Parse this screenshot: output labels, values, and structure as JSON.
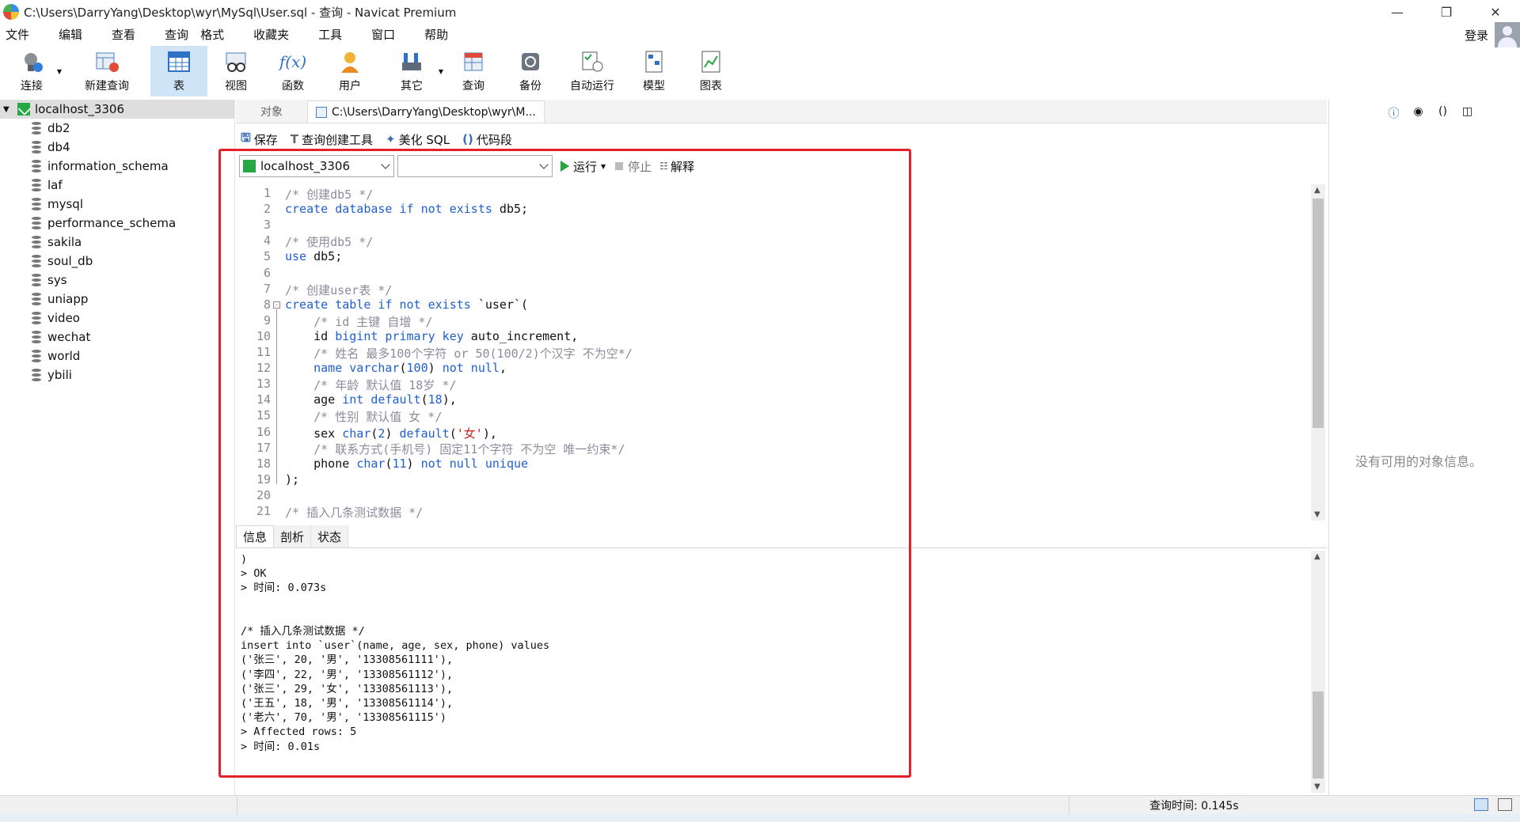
{
  "window": {
    "title": "C:\\Users\\DarryYang\\Desktop\\wyr\\MySql\\User.sql - 查询 - Navicat Premium"
  },
  "menu": [
    "文件",
    "编辑",
    "查看",
    "查询",
    "格式",
    "收藏夹",
    "工具",
    "窗口",
    "帮助"
  ],
  "login_label": "登录",
  "toolbar": [
    {
      "label": "连接",
      "icon": "plug-icon"
    },
    {
      "label": "新建查询",
      "icon": "new-query-icon"
    },
    {
      "label": "表",
      "icon": "table-icon"
    },
    {
      "label": "视图",
      "icon": "view-icon"
    },
    {
      "label": "函数",
      "icon": "function-icon"
    },
    {
      "label": "用户",
      "icon": "user-icon"
    },
    {
      "label": "其它",
      "icon": "other-icon"
    },
    {
      "label": "查询",
      "icon": "query-icon"
    },
    {
      "label": "备份",
      "icon": "backup-icon"
    },
    {
      "label": "自动运行",
      "icon": "auto-run-icon"
    },
    {
      "label": "模型",
      "icon": "model-icon"
    },
    {
      "label": "图表",
      "icon": "chart-icon"
    }
  ],
  "nav": {
    "root": "localhost_3306",
    "databases": [
      "db2",
      "db4",
      "information_schema",
      "laf",
      "mysql",
      "performance_schema",
      "sakila",
      "soul_db",
      "sys",
      "uniapp",
      "video",
      "wechat",
      "world",
      "ybili"
    ]
  },
  "tabs": {
    "objects": "对象",
    "query_tab": "C:\\Users\\DarryYang\\Desktop\\wyr\\M..."
  },
  "query_toolbar": {
    "save": "保存",
    "builder": "查询创建工具",
    "beautify": "美化 SQL",
    "snippet": "代码段"
  },
  "conn_select": "localhost_3306",
  "db_select": "",
  "run": "运行",
  "stop": "停止",
  "explain": "解释",
  "editor_lines": [
    {
      "n": "1",
      "html": "<span class='cm'>/* 创建db5 */</span>"
    },
    {
      "n": "2",
      "html": "<span class='kw'>create database if not exists</span> db5;"
    },
    {
      "n": "3",
      "html": ""
    },
    {
      "n": "4",
      "html": "<span class='cm'>/* 使用db5 */</span>"
    },
    {
      "n": "5",
      "html": "<span class='kw'>use</span> db5;"
    },
    {
      "n": "6",
      "html": ""
    },
    {
      "n": "7",
      "html": "<span class='cm'>/* 创建user表 */</span>"
    },
    {
      "n": "8",
      "html": "<span class='kw'>create table if not exists</span> `user`("
    },
    {
      "n": "9",
      "html": "    <span class='cm'>/* id 主键 自增 */</span>"
    },
    {
      "n": "10",
      "html": "    id <span class='kw'>bigint primary key</span> auto_increment,"
    },
    {
      "n": "11",
      "html": "    <span class='cm'>/* 姓名 最多100个字符 or 50(100/2)个汉字 不为空*/</span>"
    },
    {
      "n": "12",
      "html": "    <span class='kw'>name varchar</span>(<span class='kw'>100</span>) <span class='kw'>not null</span>,"
    },
    {
      "n": "13",
      "html": "    <span class='cm'>/* 年龄 默认值 18岁 */</span>"
    },
    {
      "n": "14",
      "html": "    age <span class='kw'>int default</span>(<span class='kw'>18</span>),"
    },
    {
      "n": "15",
      "html": "    <span class='cm'>/* 性别 默认值 女 */</span>"
    },
    {
      "n": "16",
      "html": "    sex <span class='kw'>char</span>(<span class='kw'>2</span>) <span class='kw'>default</span>(<span class='st'>'女'</span>),"
    },
    {
      "n": "17",
      "html": "    <span class='cm'>/* 联系方式(手机号) 固定11个字符 不为空 唯一约束*/</span>"
    },
    {
      "n": "18",
      "html": "    phone <span class='kw'>char</span>(<span class='kw'>11</span>) <span class='kw'>not null unique</span>"
    },
    {
      "n": "19",
      "html": ");"
    },
    {
      "n": "20",
      "html": ""
    },
    {
      "n": "21",
      "html": "<span class='cm'>/* 插入几条测试数据 */</span>"
    }
  ],
  "result_tabs": [
    "信息",
    "剖析",
    "状态"
  ],
  "result_text": ")\n> OK\n> 时间: 0.073s\n\n\n/* 插入几条测试数据 */\ninsert into `user`(name, age, sex, phone) values\n('张三', 20, '男', '13308561111'),\n('李四', 22, '男', '13308561112'),\n('张三', 29, '女', '13308561113'),\n('王五', 18, '男', '13308561114'),\n('老六', 70, '男', '13308561115')\n> Affected rows: 5\n> 时间: 0.01s",
  "right_pane_message": "没有可用的对象信息。",
  "status": {
    "query_time": "查询时间: 0.145s"
  }
}
